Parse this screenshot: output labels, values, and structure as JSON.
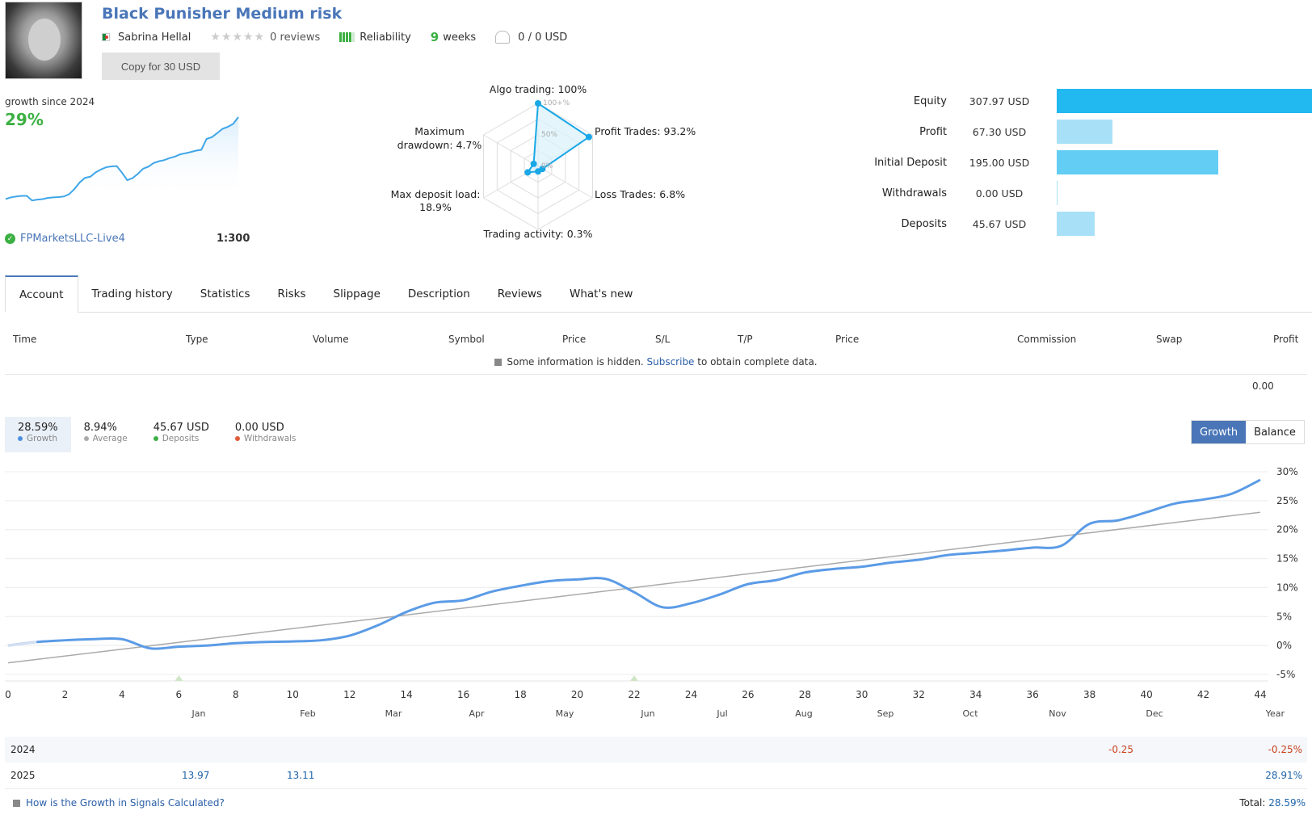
{
  "header": {
    "title": "Black Punisher Medium risk",
    "author": "Sabrina Hellal",
    "stars": "★★★★★",
    "reviews": "0 reviews",
    "reliability_label": "Reliability",
    "reliability_level": "4 of 5",
    "weeks_number": "9",
    "weeks_label": "weeks",
    "subscribers": "0 / 0 USD",
    "copy_button": "Copy for 30 USD"
  },
  "summary": {
    "growth_label": "growth since 2024",
    "growth_value": "29%",
    "server": "FPMarketsLLC-Live4",
    "leverage": "1:300"
  },
  "radar": {
    "labels": {
      "algo": "Algo trading: 100%",
      "profit": "Profit Trades: 93.2%",
      "loss": "Loss Trades: 6.8%",
      "activity": "Trading activity: 0.3%",
      "load_1": "Max deposit load:",
      "load_2": "18.9%",
      "dd_1": "Maximum",
      "dd_2": "drawdown: 4.7%"
    },
    "scale": [
      "100+%",
      "50%",
      "0%"
    ],
    "values": {
      "algo": 100,
      "profit": 93.2,
      "loss": 6.8,
      "activity": 0.3,
      "load": 18.9,
      "drawdown": 4.7
    }
  },
  "balances": [
    {
      "label": "Equity",
      "value": "307.97 USD",
      "amount": 307.97,
      "color": "#22b8f0"
    },
    {
      "label": "Profit",
      "value": "67.30 USD",
      "amount": 67.3,
      "color": "#a8e1f7"
    },
    {
      "label": "Initial Deposit",
      "value": "195.00 USD",
      "amount": 195.0,
      "color": "#63cdf3"
    },
    {
      "label": "Withdrawals",
      "value": "0.00 USD",
      "amount": 0.0,
      "color": "#a8e1f7"
    },
    {
      "label": "Deposits",
      "value": "45.67 USD",
      "amount": 45.67,
      "color": "#a8e1f7"
    }
  ],
  "tabs": [
    "Account",
    "Trading history",
    "Statistics",
    "Risks",
    "Slippage",
    "Description",
    "Reviews",
    "What's new"
  ],
  "table": {
    "columns": [
      "Time",
      "Type",
      "Volume",
      "Symbol",
      "Price",
      "S/L",
      "T/P",
      "Price",
      "Commission",
      "Swap",
      "Profit"
    ],
    "hidden_note_pre": "Some information is hidden.",
    "hidden_note_link": "Subscribe",
    "hidden_note_post": "to obtain complete data.",
    "total_profit": "0.00"
  },
  "stats": [
    {
      "value": "28.59%",
      "label": "Growth",
      "color": "#4a90e2"
    },
    {
      "value": "8.94%",
      "label": "Average",
      "color": "#aaaaaa"
    },
    {
      "value": "45.67 USD",
      "label": "Deposits",
      "color": "#3cb043"
    },
    {
      "value": "0.00 USD",
      "label": "Withdrawals",
      "color": "#e05a3a"
    }
  ],
  "toggle": {
    "growth": "Growth",
    "balance": "Balance"
  },
  "chart_data": {
    "type": "line",
    "title": "",
    "xlabel": "",
    "ylabel": "",
    "x_ticks": [
      0,
      2,
      4,
      6,
      8,
      10,
      12,
      14,
      16,
      18,
      20,
      22,
      24,
      26,
      28,
      30,
      32,
      34,
      36,
      38,
      40,
      42,
      44
    ],
    "y_ticks": [
      "30%",
      "25%",
      "20%",
      "15%",
      "10%",
      "5%",
      "0%",
      "-5%"
    ],
    "xlim": [
      0,
      44
    ],
    "ylim": [
      -5,
      30
    ],
    "grid": true,
    "series": [
      {
        "name": "Growth",
        "color": "#5b9be6",
        "x": [
          0,
          1,
          2,
          3,
          4,
          5,
          6,
          7,
          8,
          9,
          10,
          11,
          12,
          13,
          14,
          15,
          16,
          17,
          18,
          19,
          20,
          21,
          22,
          23,
          24,
          25,
          26,
          27,
          28,
          29,
          30,
          31,
          32,
          33,
          34,
          35,
          36,
          37,
          38,
          39,
          40,
          41,
          42,
          43,
          44
        ],
        "y": [
          0,
          0.6,
          0.9,
          1.1,
          1.1,
          -0.5,
          -0.2,
          0.0,
          0.4,
          0.6,
          0.7,
          0.9,
          1.7,
          3.5,
          5.8,
          7.4,
          7.8,
          9.3,
          10.3,
          11.1,
          11.4,
          11.5,
          9.2,
          6.6,
          7.3,
          8.8,
          10.6,
          11.3,
          12.6,
          13.2,
          13.6,
          14.3,
          14.8,
          15.6,
          16.0,
          16.4,
          16.9,
          17.2,
          21.0,
          21.6,
          23.0,
          24.5,
          25.2,
          26.2,
          28.6
        ]
      },
      {
        "name": "Average",
        "color": "#aaaaaa",
        "x": [
          0,
          44
        ],
        "y": [
          -3.0,
          23.0
        ]
      }
    ],
    "markers": [
      {
        "x": 6,
        "label": "deposit"
      },
      {
        "x": 22,
        "label": "deposit"
      }
    ]
  },
  "months": [
    "Jan",
    "Feb",
    "Mar",
    "Apr",
    "May",
    "Jun",
    "Jul",
    "Aug",
    "Sep",
    "Oct",
    "Nov",
    "Dec",
    "Year"
  ],
  "years": [
    {
      "year": "2024",
      "values": {
        "Dec": "-0.25"
      },
      "total": "-0.25%"
    },
    {
      "year": "2025",
      "values": {
        "Jan": "13.97",
        "Feb": "13.11"
      },
      "total": "28.91%"
    }
  ],
  "footer": {
    "link": "How is the Growth in Signals Calculated?",
    "total_label": "Total:",
    "total_value": "28.59%"
  }
}
